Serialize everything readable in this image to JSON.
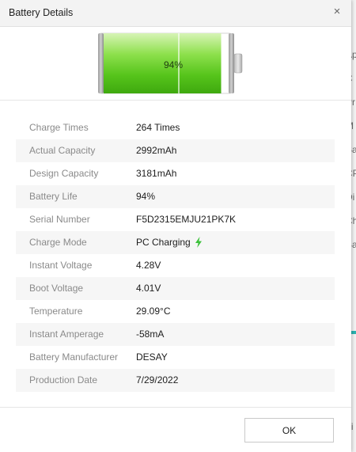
{
  "dialog": {
    "title": "Battery Details",
    "close_glyph": "×",
    "ok_label": "OK"
  },
  "battery": {
    "level_label": "94%",
    "level_fraction": 0.94,
    "fill_color": "#6cd12a",
    "charging_icon": "lightning-bolt-icon",
    "bolt_color": "#3cc13b"
  },
  "details": [
    {
      "label": "Charge Times",
      "value": "264 Times"
    },
    {
      "label": "Actual Capacity",
      "value": "2992mAh"
    },
    {
      "label": "Design Capacity",
      "value": "3181mAh"
    },
    {
      "label": "Battery Life",
      "value": "94%"
    },
    {
      "label": "Serial Number",
      "value": "F5D2315EMJU21PK7K"
    },
    {
      "label": "Charge Mode",
      "value": "PC Charging"
    },
    {
      "label": "Instant Voltage",
      "value": "4.28V"
    },
    {
      "label": "Boot Voltage",
      "value": "4.01V"
    },
    {
      "label": "Temperature",
      "value": "29.09°C"
    },
    {
      "label": "Instant Amperage",
      "value": "-58mA"
    },
    {
      "label": "Battery Manufacturer",
      "value": "DESAY"
    },
    {
      "label": "Production Date",
      "value": "7/29/2022"
    }
  ],
  "background_window": {
    "letters": [
      "Ap",
      "C",
      "Pr",
      "M",
      "Sa",
      "CP",
      "Di",
      "Ch",
      "Ba",
      "a",
      "Ti"
    ]
  }
}
